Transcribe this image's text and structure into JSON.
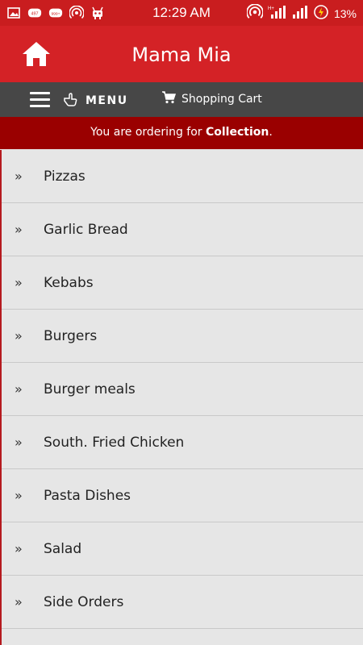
{
  "status_bar": {
    "time": "12:29 AM",
    "battery": "13%",
    "notification_icons": [
      "image-icon",
      "chat-badge-icon",
      "chat-badge-icon",
      "hotspot-icon",
      "android-icon"
    ],
    "badge_1": "497",
    "badge_2": "999+"
  },
  "app_bar": {
    "title": "Mama Mia",
    "color": "#d42226"
  },
  "nav_bar": {
    "menu_label": "MENU",
    "cart_label": "Shopping Cart"
  },
  "order_banner": {
    "prefix": "You are ordering for ",
    "mode": "Collection",
    "suffix": "."
  },
  "menu": {
    "items": [
      {
        "label": "Pizzas"
      },
      {
        "label": "Garlic Bread"
      },
      {
        "label": "Kebabs"
      },
      {
        "label": "Burgers"
      },
      {
        "label": "Burger meals"
      },
      {
        "label": "South. Fried Chicken"
      },
      {
        "label": "Pasta Dishes"
      },
      {
        "label": "Salad"
      },
      {
        "label": "Side Orders"
      }
    ],
    "chevron": "»"
  }
}
